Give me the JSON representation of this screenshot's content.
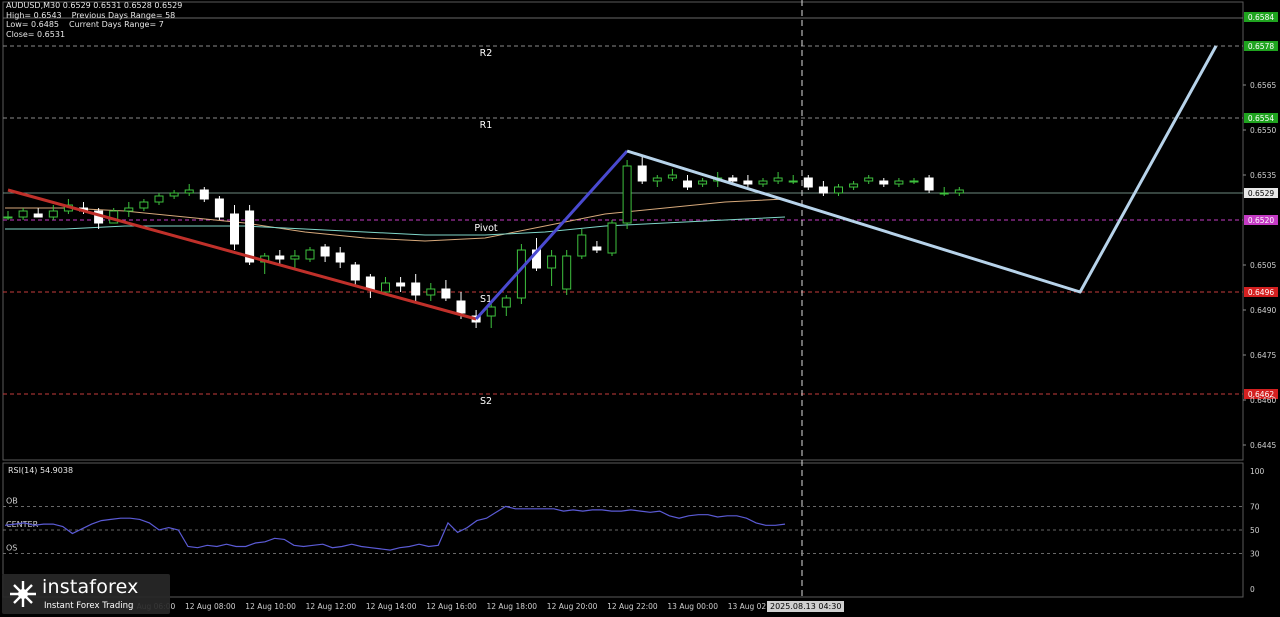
{
  "window": {
    "symbol_line": "AUDUSD,M30  0.6529 0.6531 0.6528 0.6529",
    "info_rows": [
      [
        "High= 0.6543",
        "Previous Days Range= 58"
      ],
      [
        "Low= 0.6485",
        "Current Days Range= 7"
      ],
      [
        "Close= 0.6531",
        ""
      ]
    ]
  },
  "levels": [
    {
      "label": "R2",
      "price": 0.6578,
      "color": "#8a8a8a",
      "tag_bg": "#1fa31f"
    },
    {
      "label": "R1",
      "price": 0.6554,
      "color": "#8a8a8a",
      "tag_bg": "#1fa31f"
    },
    {
      "label": "Pivot",
      "price": 0.652,
      "color": "#c43bc4",
      "tag_bg": "#c43bc4"
    },
    {
      "label": "S1",
      "price": 0.6496,
      "color": "#c43c3c",
      "tag_bg": "#d42020"
    },
    {
      "label": "S2",
      "price": 0.6462,
      "color": "#c43c3c",
      "tag_bg": "#d42020"
    }
  ],
  "top_green_tag": "0.6584",
  "current_price_tag": "0.6529",
  "price_ticks": [
    "0.6565",
    "0.6550",
    "0.6535",
    "0.6505",
    "0.6490",
    "0.6475",
    "0.6460",
    "0.6445"
  ],
  "rsi": {
    "label": "RSI(14) 54.9038",
    "ticks": [
      "100",
      "70",
      "50",
      "30",
      "0"
    ],
    "zones": [
      "OB",
      "CENTER",
      "OS"
    ],
    "values": [
      54,
      55,
      56,
      54,
      55,
      55,
      53,
      47,
      51,
      55,
      58,
      59,
      60,
      60,
      59,
      56,
      50,
      52,
      50,
      36,
      35,
      37,
      36,
      38,
      36,
      36,
      39,
      40,
      43,
      42,
      37,
      36,
      37,
      38,
      35,
      36,
      38,
      36,
      35,
      34,
      33,
      35,
      36,
      38,
      36,
      37,
      56,
      48,
      52,
      58,
      60,
      65,
      70,
      68,
      68,
      68,
      68,
      68,
      66,
      67,
      66,
      67,
      67,
      66,
      66,
      67,
      66,
      65,
      66,
      62,
      60,
      62,
      63,
      63,
      61,
      62,
      62,
      60,
      56,
      54,
      54,
      55
    ]
  },
  "time_labels": [
    "12 Aug 06:00",
    "12 Aug 08:00",
    "12 Aug 10:00",
    "12 Aug 12:00",
    "12 Aug 14:00",
    "12 Aug 16:00",
    "12 Aug 18:00",
    "12 Aug 20:00",
    "12 Aug 22:00",
    "13 Aug 00:00",
    "13 Aug 02:00"
  ],
  "datetime_box": "2025.08.13 04:30",
  "brand": {
    "name": "instaforex",
    "tagline": "Instant Forex Trading"
  },
  "chart_data": {
    "type": "candlestick",
    "symbol": "AUDUSD",
    "timeframe": "M30",
    "ylim": [
      0.644,
      0.659
    ],
    "candles": [
      [
        0.6521,
        0.6523,
        0.652,
        0.6521
      ],
      [
        0.6521,
        0.6524,
        0.652,
        0.6523
      ],
      [
        0.6522,
        0.6524,
        0.6521,
        0.6521
      ],
      [
        0.6521,
        0.6525,
        0.652,
        0.6523
      ],
      [
        0.6523,
        0.6527,
        0.6522,
        0.6525
      ],
      [
        0.6524,
        0.6526,
        0.6522,
        0.6523
      ],
      [
        0.6523,
        0.6524,
        0.6517,
        0.6519
      ],
      [
        0.6519,
        0.6524,
        0.6519,
        0.6523
      ],
      [
        0.6523,
        0.6526,
        0.6521,
        0.6524
      ],
      [
        0.6524,
        0.6527,
        0.6523,
        0.6526
      ],
      [
        0.6526,
        0.6529,
        0.6525,
        0.6528
      ],
      [
        0.6528,
        0.653,
        0.6527,
        0.6529
      ],
      [
        0.6529,
        0.6532,
        0.6528,
        0.653
      ],
      [
        0.653,
        0.6531,
        0.6526,
        0.6527
      ],
      [
        0.6527,
        0.6528,
        0.652,
        0.6521
      ],
      [
        0.6522,
        0.6525,
        0.651,
        0.6512
      ],
      [
        0.6523,
        0.6525,
        0.6505,
        0.6506
      ],
      [
        0.6506,
        0.6509,
        0.6502,
        0.6508
      ],
      [
        0.6508,
        0.651,
        0.6505,
        0.6507
      ],
      [
        0.6507,
        0.651,
        0.6504,
        0.6508
      ],
      [
        0.6507,
        0.6511,
        0.6506,
        0.651
      ],
      [
        0.6511,
        0.6512,
        0.6506,
        0.6508
      ],
      [
        0.6509,
        0.6511,
        0.6504,
        0.6506
      ],
      [
        0.6505,
        0.6506,
        0.6498,
        0.65
      ],
      [
        0.6501,
        0.6502,
        0.6494,
        0.6497
      ],
      [
        0.6496,
        0.6501,
        0.6495,
        0.6499
      ],
      [
        0.6499,
        0.6501,
        0.6496,
        0.6498
      ],
      [
        0.6499,
        0.6502,
        0.6493,
        0.6495
      ],
      [
        0.6495,
        0.6499,
        0.6493,
        0.6497
      ],
      [
        0.6497,
        0.65,
        0.6493,
        0.6494
      ],
      [
        0.6493,
        0.6496,
        0.6487,
        0.6489
      ],
      [
        0.6488,
        0.649,
        0.6484,
        0.6486
      ],
      [
        0.6488,
        0.6492,
        0.6484,
        0.6491
      ],
      [
        0.6491,
        0.6495,
        0.6488,
        0.6494
      ],
      [
        0.6494,
        0.6512,
        0.6492,
        0.651
      ],
      [
        0.651,
        0.6514,
        0.6503,
        0.6504
      ],
      [
        0.6504,
        0.651,
        0.6498,
        0.6508
      ],
      [
        0.6497,
        0.651,
        0.6495,
        0.6508
      ],
      [
        0.6508,
        0.6517,
        0.6507,
        0.6515
      ],
      [
        0.6511,
        0.6513,
        0.6509,
        0.651
      ],
      [
        0.6509,
        0.652,
        0.6508,
        0.6519
      ],
      [
        0.6519,
        0.654,
        0.6517,
        0.6538
      ],
      [
        0.6538,
        0.6541,
        0.6532,
        0.6533
      ],
      [
        0.6533,
        0.6535,
        0.6531,
        0.6534
      ],
      [
        0.6534,
        0.6537,
        0.6533,
        0.6535
      ],
      [
        0.6533,
        0.6535,
        0.653,
        0.6531
      ],
      [
        0.6532,
        0.6534,
        0.6531,
        0.6533
      ],
      [
        0.6533,
        0.6536,
        0.6531,
        0.6534
      ],
      [
        0.6534,
        0.6535,
        0.6532,
        0.6533
      ],
      [
        0.6533,
        0.6535,
        0.6531,
        0.6532
      ],
      [
        0.6532,
        0.6534,
        0.6531,
        0.6533
      ],
      [
        0.6533,
        0.6536,
        0.6532,
        0.6534
      ],
      [
        0.6533,
        0.6535,
        0.6532,
        0.6533
      ],
      [
        0.6534,
        0.6535,
        0.653,
        0.6531
      ],
      [
        0.6531,
        0.6533,
        0.6528,
        0.6529
      ],
      [
        0.6529,
        0.6532,
        0.6528,
        0.6531
      ],
      [
        0.6531,
        0.6533,
        0.653,
        0.6532
      ],
      [
        0.6533,
        0.6535,
        0.6532,
        0.6534
      ],
      [
        0.6533,
        0.6534,
        0.6531,
        0.6532
      ],
      [
        0.6532,
        0.6534,
        0.6531,
        0.6533
      ],
      [
        0.6533,
        0.6534,
        0.6532,
        0.6533
      ],
      [
        0.6534,
        0.6535,
        0.6529,
        0.653
      ],
      [
        0.6529,
        0.6531,
        0.6528,
        0.6529
      ],
      [
        0.6529,
        0.6531,
        0.6528,
        0.653
      ]
    ],
    "moving_averages": [
      {
        "color": "#d7a97b",
        "values": [
          0.6524,
          0.6524,
          0.6523,
          0.6521,
          0.6519,
          0.6516,
          0.6514,
          0.6513,
          0.6514,
          0.6518,
          0.6522,
          0.6524,
          0.6526,
          0.6527
        ]
      },
      {
        "color": "#7fd6c9",
        "values": [
          0.6517,
          0.6517,
          0.6518,
          0.6518,
          0.6518,
          0.6517,
          0.6516,
          0.6515,
          0.6515,
          0.6516,
          0.6518,
          0.6519,
          0.652,
          0.6521
        ]
      }
    ],
    "swing_lines": [
      {
        "color": "#c0302a",
        "points": [
          [
            0.653,
            0
          ],
          [
            0.6487,
            31
          ]
        ]
      },
      {
        "color": "#4a4ad0",
        "points": [
          [
            0.6487,
            31
          ],
          [
            0.6543,
            41
          ]
        ]
      },
      {
        "color": "#b7d3ea",
        "points": [
          [
            0.6543,
            41
          ],
          [
            0.6496,
            71
          ],
          [
            0.6578,
            80
          ]
        ]
      }
    ]
  }
}
